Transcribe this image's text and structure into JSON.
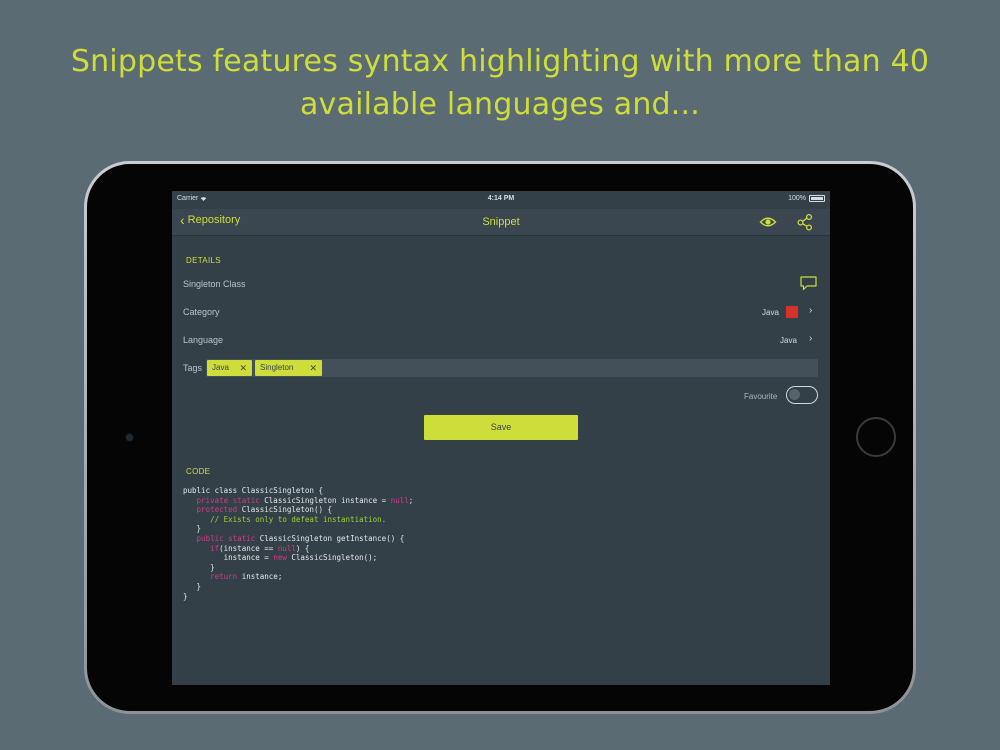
{
  "headline": "Snippets features syntax highlighting with more than 40 available languages and...",
  "status_bar": {
    "carrier": "Carrier",
    "time": "4:14 PM",
    "battery": "100%"
  },
  "nav": {
    "back_label": "Repository",
    "title": "Snippet"
  },
  "details": {
    "section_label": "DETAILS",
    "name": "Singleton Class",
    "category_label": "Category",
    "category_value": "Java",
    "category_color": "#d8312b",
    "language_label": "Language",
    "language_value": "Java",
    "tags_label": "Tags",
    "tags": [
      "Java",
      "Singleton"
    ],
    "favourite_label": "Favourite",
    "favourite": false,
    "save_label": "Save"
  },
  "code": {
    "section_label": "CODE",
    "lines": [
      "public class ClassicSingleton {",
      "   private static ClassicSingleton instance = null;",
      "   protected ClassicSingleton() {",
      "      // Exists only to defeat instantiation.",
      "   }",
      "   public static ClassicSingleton getInstance() {",
      "      if(instance == null) {",
      "         instance = new ClassicSingleton();",
      "      }",
      "      return instance;",
      "   }",
      "}"
    ]
  },
  "colors": {
    "accent": "#cfdd3a",
    "keyword": "#cf3a8b",
    "comment": "#9fcf3a",
    "background": "#5a6b74",
    "screen": "#344048"
  },
  "icons": [
    "chevron-left-icon",
    "eye-icon",
    "share-icon",
    "comment-icon",
    "chevron-right-icon",
    "wifi-icon",
    "battery-icon"
  ]
}
